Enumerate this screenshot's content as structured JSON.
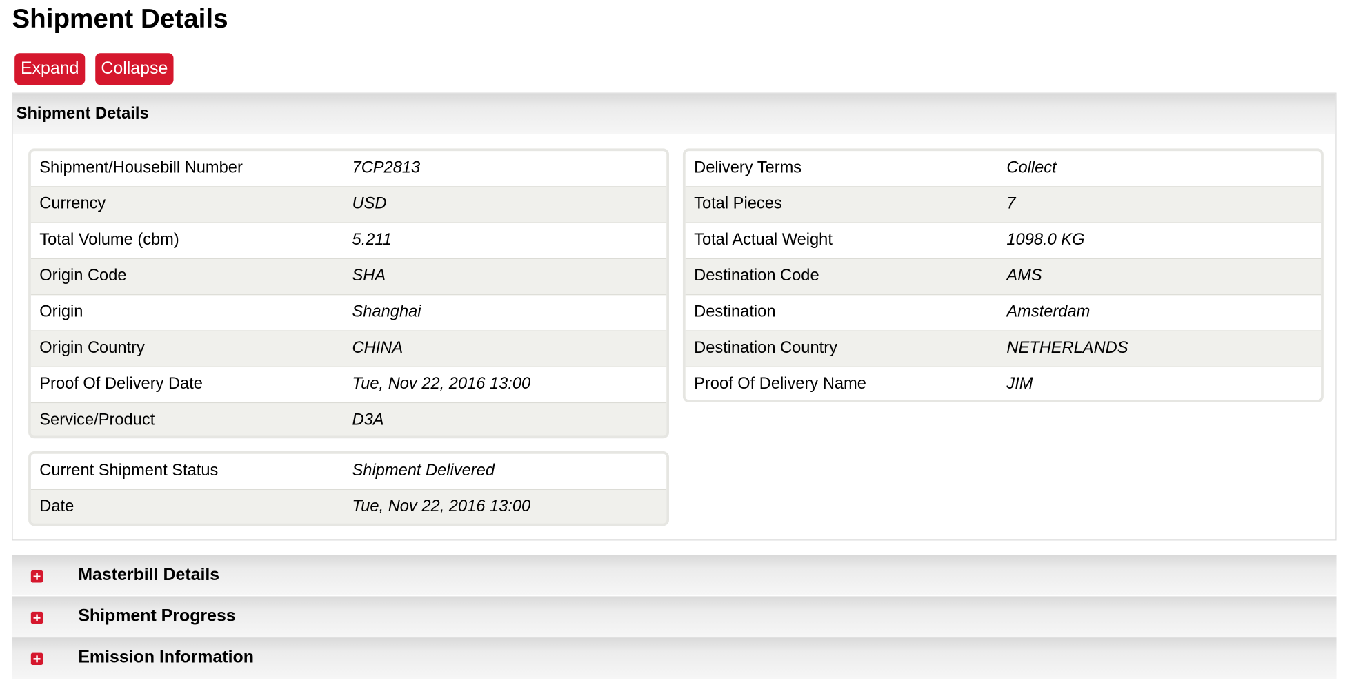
{
  "page": {
    "title": "Shipment Details"
  },
  "toolbar": {
    "expand_label": "Expand",
    "collapse_label": "Collapse"
  },
  "panel": {
    "title": "Shipment Details"
  },
  "left_card": {
    "rows": [
      {
        "label": "Shipment/Housebill Number",
        "value": "7CP2813"
      },
      {
        "label": "Currency",
        "value": "USD"
      },
      {
        "label": "Total Volume (cbm)",
        "value": "5.211"
      },
      {
        "label": "Origin Code",
        "value": "SHA"
      },
      {
        "label": "Origin",
        "value": "Shanghai"
      },
      {
        "label": "Origin Country",
        "value": "CHINA"
      },
      {
        "label": "Proof Of Delivery Date",
        "value": "Tue, Nov 22, 2016 13:00"
      },
      {
        "label": "Service/Product",
        "value": "D3A"
      }
    ]
  },
  "right_card": {
    "rows": [
      {
        "label": "Delivery Terms",
        "value": "Collect"
      },
      {
        "label": "Total Pieces",
        "value": "7"
      },
      {
        "label": "Total Actual Weight",
        "value": "1098.0 KG"
      },
      {
        "label": "Destination Code",
        "value": "AMS"
      },
      {
        "label": "Destination",
        "value": "Amsterdam"
      },
      {
        "label": "Destination Country",
        "value": "NETHERLANDS"
      },
      {
        "label": "Proof Of Delivery Name",
        "value": "JIM"
      }
    ]
  },
  "status_card": {
    "rows": [
      {
        "label": "Current Shipment Status",
        "value": "Shipment Delivered"
      },
      {
        "label": "Date",
        "value": "Tue, Nov 22, 2016 13:00"
      }
    ]
  },
  "sections": [
    {
      "title": "Masterbill Details",
      "icon": "plus-icon"
    },
    {
      "title": "Shipment Progress",
      "icon": "plus-icon"
    },
    {
      "title": "Emission Information",
      "icon": "plus-icon"
    }
  ],
  "colors": {
    "accent": "#d5172d",
    "row_alt": "#f0f0ec",
    "header_bg": "#e6e6e6"
  }
}
